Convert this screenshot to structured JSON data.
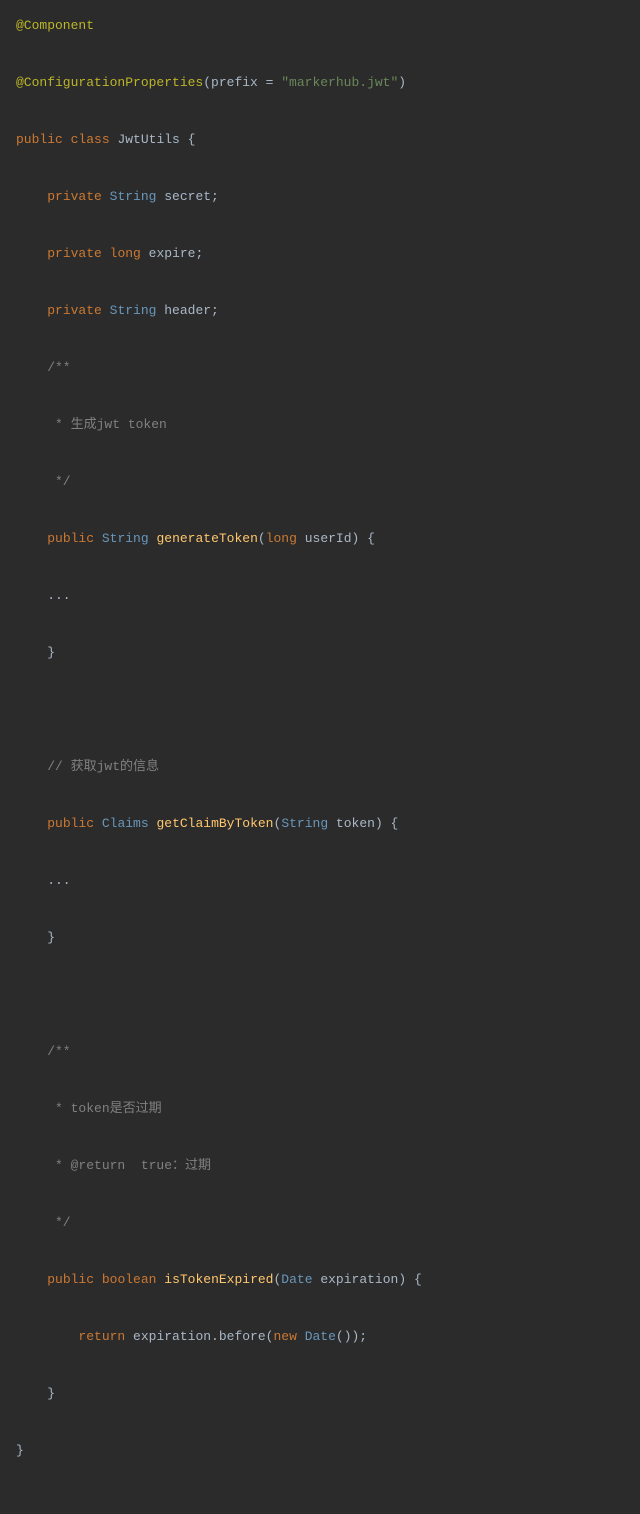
{
  "code": {
    "l1_a": "@Component",
    "l2_a": "@ConfigurationProperties",
    "l2_b": "(prefix = ",
    "l2_c": "\"markerhub.jwt\"",
    "l2_d": ")",
    "l3_a": "public",
    "l3_b": " ",
    "l3_c": "class",
    "l3_d": " ",
    "l3_e": "JwtUtils",
    "l3_f": " {",
    "l4_a": "    ",
    "l4_b": "private",
    "l4_c": " ",
    "l4_d": "String",
    "l4_e": " secret;",
    "l5_a": "    ",
    "l5_b": "private",
    "l5_c": " ",
    "l5_d": "long",
    "l5_e": " expire;",
    "l6_a": "    ",
    "l6_b": "private",
    "l6_c": " ",
    "l6_d": "String",
    "l6_e": " header;",
    "l7": "    /**",
    "l8": "     * 生成jwt token",
    "l9": "     */",
    "l10_a": "    ",
    "l10_b": "public",
    "l10_c": " ",
    "l10_d": "String",
    "l10_e": " ",
    "l10_f": "generateToken",
    "l10_g": "(",
    "l10_h": "long",
    "l10_i": " userId",
    "l10_j": ")",
    "l10_k": " {",
    "l11": "    ...",
    "l12": "    }",
    "blank": " ",
    "l13": "    // 获取jwt的信息",
    "l14_a": "    ",
    "l14_b": "public",
    "l14_c": " ",
    "l14_d": "Claims",
    "l14_e": " ",
    "l14_f": "getClaimByToken",
    "l14_g": "(",
    "l14_h": "String",
    "l14_i": " token",
    "l14_j": ")",
    "l14_k": " {",
    "l15": "    ...",
    "l16": "    }",
    "l17": "    /**",
    "l18": "     * token是否过期",
    "l19": "     * @return  true：过期",
    "l20": "     */",
    "l21_a": "    ",
    "l21_b": "public",
    "l21_c": " ",
    "l21_d": "boolean",
    "l21_e": " ",
    "l21_f": "isTokenExpired",
    "l21_g": "(",
    "l21_h": "Date",
    "l21_i": " expiration",
    "l21_j": ")",
    "l21_k": " {",
    "l22_a": "        ",
    "l22_b": "return",
    "l22_c": " expiration.before(",
    "l22_d": "new",
    "l22_e": " ",
    "l22_f": "Date",
    "l22_g": "());",
    "l23": "    }",
    "l24": "}"
  }
}
